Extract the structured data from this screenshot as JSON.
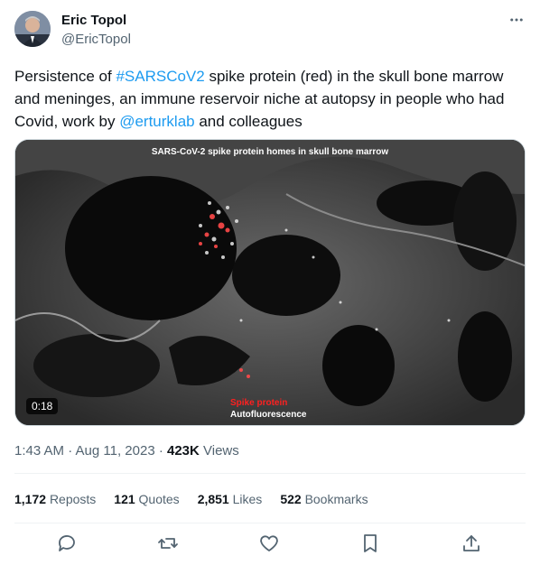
{
  "author": {
    "name": "Eric Topol",
    "handle": "@EricTopol"
  },
  "tweet": {
    "text_parts": [
      "Persistence of ",
      "#SARSCoV2",
      " spike protein (red) in the skull bone marrow and meninges, an immune reservoir niche at autopsy in people who had Covid, work by ",
      "@erturklab",
      " and colleagues"
    ]
  },
  "media": {
    "title": "SARS-CoV-2 spike protein homes in skull bone marrow",
    "duration": "0:18",
    "legend_red": "Spike protein",
    "legend_white": "Autofluorescence"
  },
  "meta": {
    "timestamp": "1:43 AM · Aug 11, 2023 · ",
    "views_count": "423K",
    "views_label": " Views"
  },
  "stats": {
    "reposts": {
      "count": "1,172",
      "label": "Reposts"
    },
    "quotes": {
      "count": "121",
      "label": "Quotes"
    },
    "likes": {
      "count": "2,851",
      "label": "Likes"
    },
    "bookmarks": {
      "count": "522",
      "label": "Bookmarks"
    }
  },
  "colors": {
    "link": "#1d9bf0",
    "muted": "#536471",
    "text": "#0f1419"
  }
}
